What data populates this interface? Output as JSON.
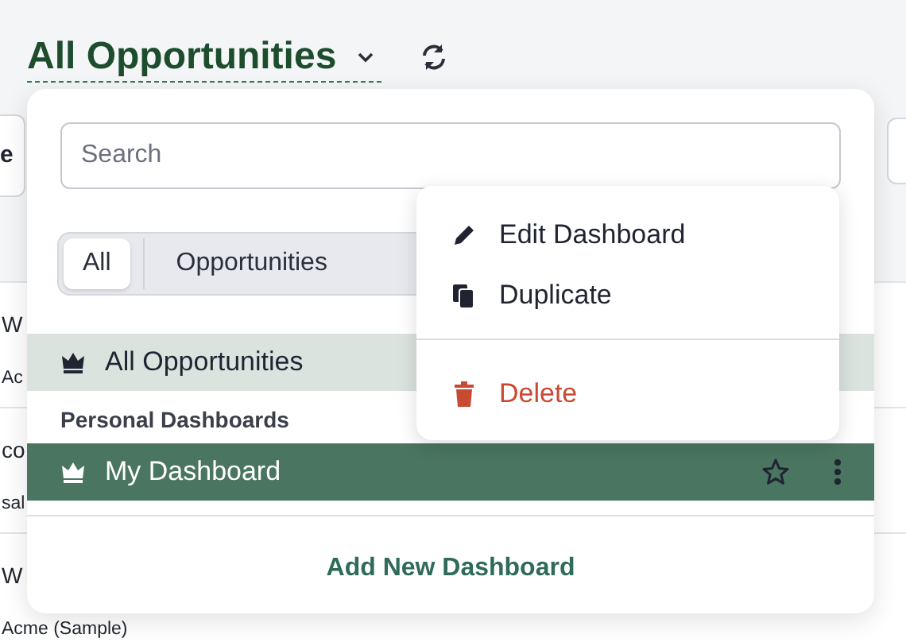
{
  "header": {
    "title": "All Opportunities"
  },
  "background": {
    "toolbar_text": "e",
    "rows": [
      {
        "title": "W",
        "subtitle": "Ac"
      },
      {
        "title": "co",
        "subtitle": "sal"
      },
      {
        "title": "W",
        "subtitle": "Acme (Sample)"
      }
    ]
  },
  "dropdown": {
    "search": {
      "placeholder": "Search"
    },
    "tabs": [
      {
        "label": "All",
        "selected": true
      },
      {
        "label": "Opportunities",
        "selected": false
      }
    ],
    "items": [
      {
        "kind": "item",
        "label": "All Opportunities",
        "selected": false,
        "hover": true
      },
      {
        "kind": "header",
        "label": "Personal Dashboards"
      },
      {
        "kind": "item",
        "label": "My Dashboard",
        "selected": true,
        "hover": false
      }
    ],
    "add_button": "Add New Dashboard"
  },
  "context_menu": [
    {
      "kind": "edit",
      "label": "Edit Dashboard"
    },
    {
      "kind": "copy",
      "label": "Duplicate"
    },
    {
      "kind": "divider"
    },
    {
      "kind": "delete",
      "label": "Delete"
    }
  ]
}
